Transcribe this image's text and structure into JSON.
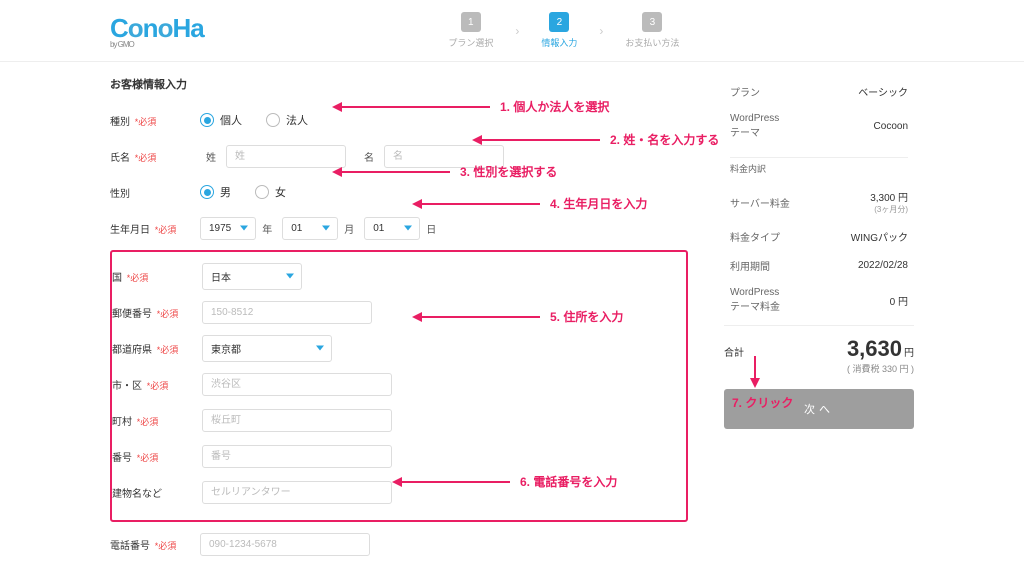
{
  "brand": {
    "name": "ConoHa",
    "subtitle": "by GMO"
  },
  "steps": {
    "s1": {
      "num": "1",
      "label": "プラン選択"
    },
    "s2": {
      "num": "2",
      "label": "情報入力"
    },
    "s3": {
      "num": "3",
      "label": "お支払い方法"
    }
  },
  "section_title": "お客様情報入力",
  "required_mark": "*必須",
  "form": {
    "type": {
      "label": "種別",
      "opt1": "個人",
      "opt2": "法人"
    },
    "name": {
      "label": "氏名",
      "sub1": "姓",
      "ph1": "姓",
      "sub2": "名",
      "ph2": "名"
    },
    "gender": {
      "label": "性別",
      "opt1": "男",
      "opt2": "女"
    },
    "birth": {
      "label": "生年月日",
      "year": "1975",
      "ysuf": "年",
      "month": "01",
      "msuf": "月",
      "day": "01",
      "dsuf": "日"
    },
    "country": {
      "label": "国",
      "value": "日本"
    },
    "zip": {
      "label": "郵便番号",
      "ph": "150-8512"
    },
    "pref": {
      "label": "都道府県",
      "value": "東京都"
    },
    "city": {
      "label": "市・区",
      "ph": "渋谷区"
    },
    "town": {
      "label": "町村",
      "ph": "桜丘町"
    },
    "street": {
      "label": "番号",
      "ph": "番号"
    },
    "building": {
      "label": "建物名など",
      "ph": "セルリアンタワー"
    },
    "phone": {
      "label": "電話番号",
      "ph": "090-1234-5678"
    }
  },
  "side": {
    "plan_k": "プラン",
    "plan_v": "ベーシック",
    "theme_k": "WordPress\nテーマ",
    "theme_v": "Cocoon",
    "breakdown": "料金内訳",
    "server_k": "サーバー料金",
    "server_v": "3,300 円",
    "server_note": "(3ヶ月分)",
    "type_k": "料金タイプ",
    "type_v": "WINGパック",
    "period_k": "利用期間",
    "period_v": "2022/02/28",
    "themefee_k": "WordPress\nテーマ料金",
    "themefee_v": "0 円",
    "total_k": "合計",
    "total_v": "3,630",
    "total_yen": "円",
    "tax_note": "( 消費税 330 円 )",
    "next": "次へ"
  },
  "ann": {
    "a1": "1.  個人か法人を選択",
    "a2": "2. 姓・名を入力する",
    "a3": "3. 性別を選択する",
    "a4": "4. 生年月日を入力",
    "a5": "5. 住所を入力",
    "a6": "6. 電話番号を入力",
    "a7": "7. クリック"
  }
}
